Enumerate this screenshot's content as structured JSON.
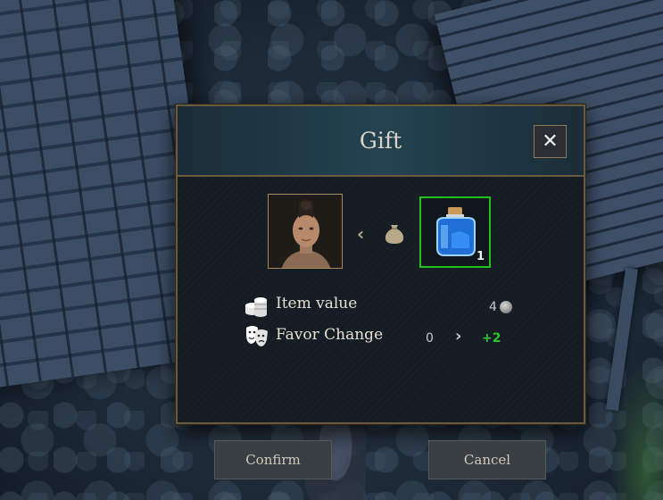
{
  "dialog": {
    "title": "Gift",
    "close_icon": "close-icon",
    "recipient_portrait": "npc-portrait",
    "direction_icon": "chevron-left-icon",
    "bag_icon": "coin-bag-icon",
    "item": {
      "icon": "blue-potion-bottle-icon",
      "count": "1",
      "selected_border_color": "#1ec21e"
    },
    "item_value": {
      "icon": "coin-stack-icon",
      "label": "Item value",
      "value": "4",
      "currency_icon": "silver-coin-icon"
    },
    "favor_change": {
      "icon": "theater-masks-icon",
      "label": "Favor Change",
      "from": "0",
      "arrow_icon": "chevron-right-icon",
      "gain": "+2",
      "gain_color": "#28c828"
    },
    "confirm_label": "Confirm",
    "cancel_label": "Cancel"
  }
}
